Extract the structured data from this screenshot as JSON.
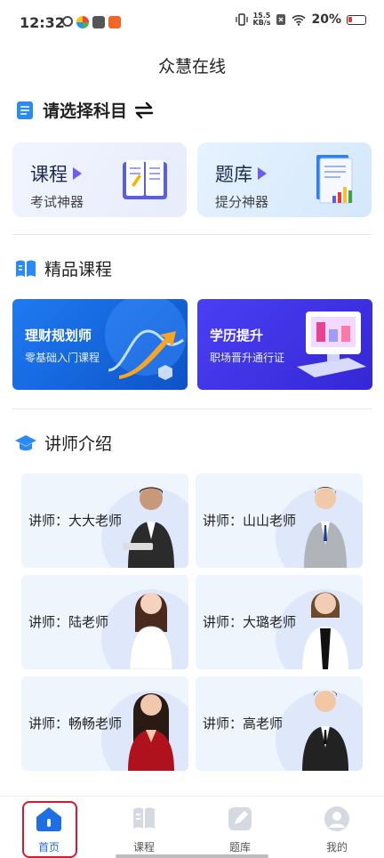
{
  "status_bar": {
    "time": "12:32",
    "net_speed_top": "15.5",
    "net_speed_bottom": "KB/s",
    "battery": "20%"
  },
  "app": {
    "title": "众慧在线"
  },
  "subject_section": {
    "title": "请选择科目",
    "swap_icon": "swap-arrows-icon"
  },
  "subject_cards": [
    {
      "title": "课程",
      "subtitle": "考试神器",
      "icon": "open-book-icon"
    },
    {
      "title": "题库",
      "subtitle": "提分神器",
      "icon": "document-chart-icon"
    }
  ],
  "premium_section": {
    "title": "精品课程",
    "icon": "book-icon"
  },
  "banners": [
    {
      "title": "理财规划师",
      "subtitle": "零基础入门课程"
    },
    {
      "title": "学历提升",
      "subtitle": "职场晋升通行证"
    }
  ],
  "teacher_section": {
    "title": "讲师介绍",
    "icon": "graduation-cap-icon"
  },
  "teachers": [
    {
      "label": "讲师：大大老师"
    },
    {
      "label": "讲师：山山老师"
    },
    {
      "label": "讲师：陆老师"
    },
    {
      "label": "讲师：大璐老师"
    },
    {
      "label": "讲师：畅畅老师"
    },
    {
      "label": "讲师：高老师"
    }
  ],
  "bottom_nav": [
    {
      "label": "首页",
      "active": true
    },
    {
      "label": "课程",
      "active": false
    },
    {
      "label": "题库",
      "active": false
    },
    {
      "label": "我的",
      "active": false
    }
  ],
  "colors": {
    "accent": "#1e6fe6",
    "highlight": "#d9182b",
    "purple": "#6f5cf0"
  }
}
